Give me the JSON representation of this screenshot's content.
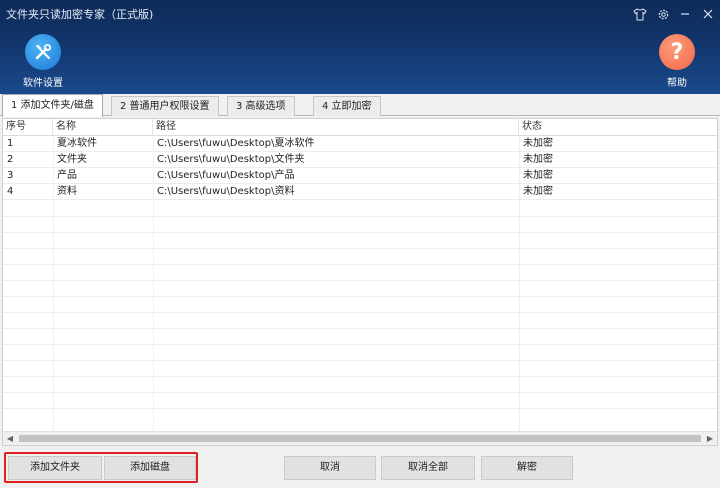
{
  "window": {
    "title": "文件夹只读加密专家（正式版)",
    "controls": {
      "skin_icon": "tshirt-icon",
      "settings_icon": "gear-icon",
      "minimize_icon": "minimize-icon",
      "close_icon": "close-icon"
    }
  },
  "toolbar": {
    "settings_label": "软件设置",
    "help_label": "帮助",
    "help_glyph": "?"
  },
  "tabs": [
    {
      "label": "1 添加文件夹/磁盘",
      "active": true
    },
    {
      "label": "2 普通用户权限设置",
      "active": false
    },
    {
      "label": "3 高级选项",
      "active": false
    },
    {
      "label": "4 立即加密",
      "active": false
    }
  ],
  "table": {
    "columns": [
      "序号",
      "名称",
      "路径",
      "状态"
    ],
    "rows": [
      {
        "index": "1",
        "name": "夏冰软件",
        "path": "C:\\Users\\fuwu\\Desktop\\夏冰软件",
        "status": "未加密"
      },
      {
        "index": "2",
        "name": "文件夹",
        "path": "C:\\Users\\fuwu\\Desktop\\文件夹",
        "status": "未加密"
      },
      {
        "index": "3",
        "name": "产品",
        "path": "C:\\Users\\fuwu\\Desktop\\产品",
        "status": "未加密"
      },
      {
        "index": "4",
        "name": "资料",
        "path": "C:\\Users\\fuwu\\Desktop\\资料",
        "status": "未加密"
      }
    ]
  },
  "buttons": {
    "add_folder": "添加文件夹",
    "add_disk": "添加磁盘",
    "cancel": "取消",
    "cancel_all": "取消全部",
    "decrypt": "解密"
  },
  "colors": {
    "header_bg": "#12356b",
    "settings_icon_bg": "#1a78d6",
    "help_icon_bg": "#f06a48",
    "highlight_border": "#e02020"
  }
}
